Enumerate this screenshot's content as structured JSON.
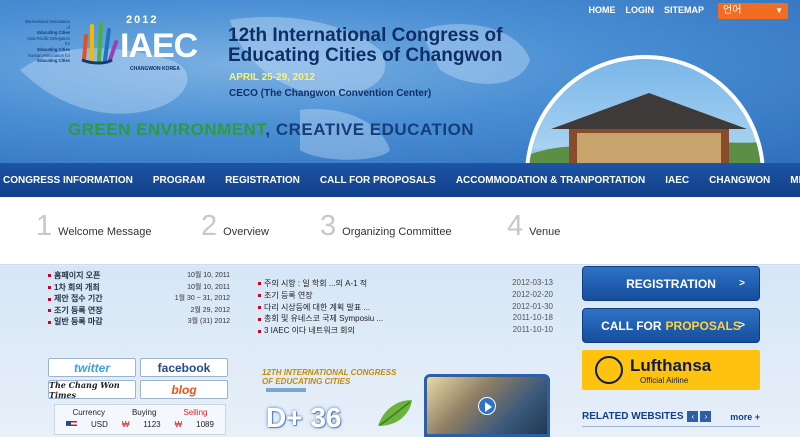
{
  "header": {
    "top_links": [
      "HOME",
      "LOGIN",
      "SITEMAP"
    ],
    "language": "언어",
    "logo_fine_print": [
      "International Association of",
      "Educating Cities",
      "Asia-Pacific Delegation for",
      "Educating Cities",
      "Korean Association for",
      "Educating Cities"
    ],
    "logo_year": "2012",
    "logo_word": "IAEC",
    "logo_sub": "CHANGWON KOREA",
    "title_line1": "12th International Congress of",
    "title_line2": "Educating Cities of Changwon",
    "date": "APRIL 25-29, 2012",
    "venue": "CECO (The Changwon Convention Center)",
    "slogan_green": "GREEN ENVIRONMENT",
    "slogan_rest": ", CREATIVE EDUCATION"
  },
  "nav": [
    "CONGRESS INFORMATION",
    "PROGRAM",
    "REGISTRATION",
    "CALL FOR PROPOSALS",
    "ACCOMMODATION & TRANPORTATION",
    "IAEC",
    "CHANGWON",
    "MEDIA CENTER"
  ],
  "submenu": [
    {
      "num": "1",
      "label": "Welcome Message"
    },
    {
      "num": "2",
      "label": "Overview"
    },
    {
      "num": "3",
      "label": "Organizing Committee"
    },
    {
      "num": "4",
      "label": "Venue"
    }
  ],
  "schedule": [
    {
      "label": "홈페이지 오픈",
      "date": "10월 10, 2011"
    },
    {
      "label": "1차 회의 개최",
      "date": "10월 10, 2011"
    },
    {
      "label": "제안 접수 기간",
      "date": "1월 30 ~ 31, 2012"
    },
    {
      "label": "조기 등록 연장",
      "date": "2월 29, 2012"
    },
    {
      "label": "일반 등록 마감",
      "date": "3월 (31) 2012"
    }
  ],
  "social": {
    "twitter": "twitter",
    "facebook": "facebook",
    "paper": "The Chang Won Times",
    "blog": "blog"
  },
  "currency": {
    "headers": [
      "Currency",
      "Buying",
      "Selling"
    ],
    "code": "USD",
    "symbol": "₩",
    "buying": "1123",
    "selling": "1089"
  },
  "news": [
    {
      "title": "주의 시항 : 일 학회 ...의 A-1 적",
      "date": "2012-03-13"
    },
    {
      "title": "조기 등록 연장",
      "date": "2012-02-20"
    },
    {
      "title": "다리 시상등에 대한 계획 발표 ...",
      "date": "2012-01-30"
    },
    {
      "title": "총회 및 유네스코 국제 Symposiu ...",
      "date": "2011-10-18"
    },
    {
      "title": "3 IAEC 이다 네트워크 회의",
      "date": "2011-10-10"
    }
  ],
  "promo": {
    "congress_line1": "12TH INTERNATIONAL CONGRESS",
    "congress_line2": "OF EDUCATING CITIES",
    "dday": "D+ 36"
  },
  "right": {
    "registration": "REGISTRATION",
    "cfp_prefix": "CALL FOR",
    "cfp_highlight": "PROPOSALS",
    "lufthansa_name": "Lufthansa",
    "lufthansa_tag": "Official Airline",
    "related": "RELATED WEBSITES",
    "more": "more +"
  }
}
